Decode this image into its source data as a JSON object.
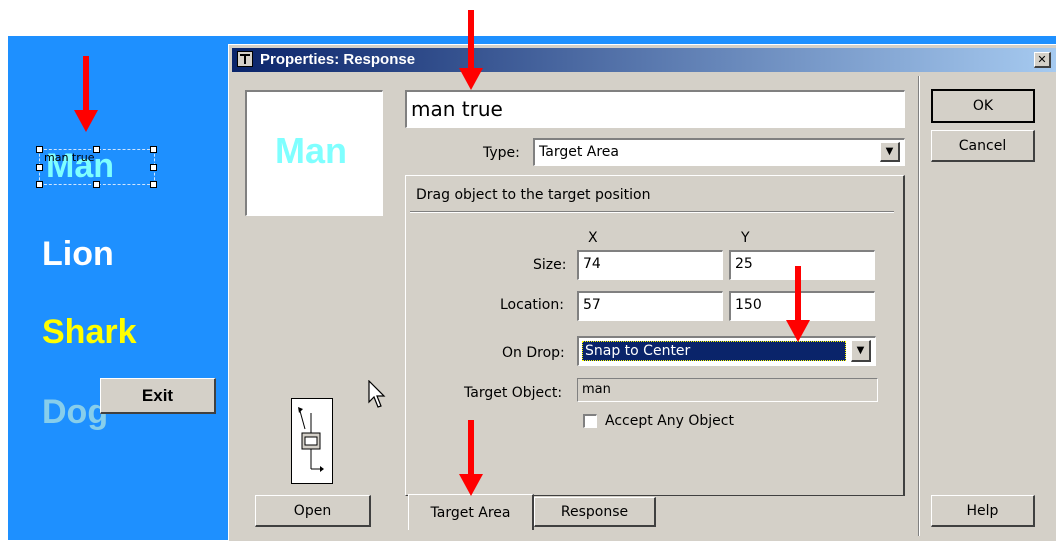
{
  "stage": {
    "selected_word": "Man",
    "selected_label": "man true",
    "words": [
      {
        "text": "Lion",
        "color": "#ffffff"
      },
      {
        "text": "Shark",
        "color": "#ffff00"
      },
      {
        "text": "Dog",
        "color": "#87ceeb"
      }
    ],
    "exit_label": "Exit"
  },
  "dialog": {
    "title": "Properties: Response",
    "close_glyph": "✕",
    "preview_text": "Man",
    "name_value": "man true",
    "type_label": "Type:",
    "type_value": "Target Area",
    "panel_heading": "Drag object to the target position",
    "col_x": "X",
    "col_y": "Y",
    "size_label": "Size:",
    "size_x": "74",
    "size_y": "25",
    "location_label": "Location:",
    "location_x": "57",
    "location_y": "150",
    "ondrop_label": "On Drop:",
    "ondrop_value": "Snap to Center",
    "target_object_label": "Target Object:",
    "target_object_value": "man",
    "accept_any_label": "Accept Any Object",
    "accept_any_checked": false,
    "open_label": "Open",
    "ok_label": "OK",
    "cancel_label": "Cancel",
    "help_label": "Help",
    "tabs": [
      {
        "label": "Target Area",
        "active": true
      },
      {
        "label": "Response",
        "active": false
      }
    ]
  },
  "colors": {
    "stage_bg": "#1e90ff",
    "dialog_bg": "#d4d0c8",
    "titlebar": "#0a246a",
    "annotation_arrow": "#ff0000",
    "preview_text": "#7fffff"
  }
}
